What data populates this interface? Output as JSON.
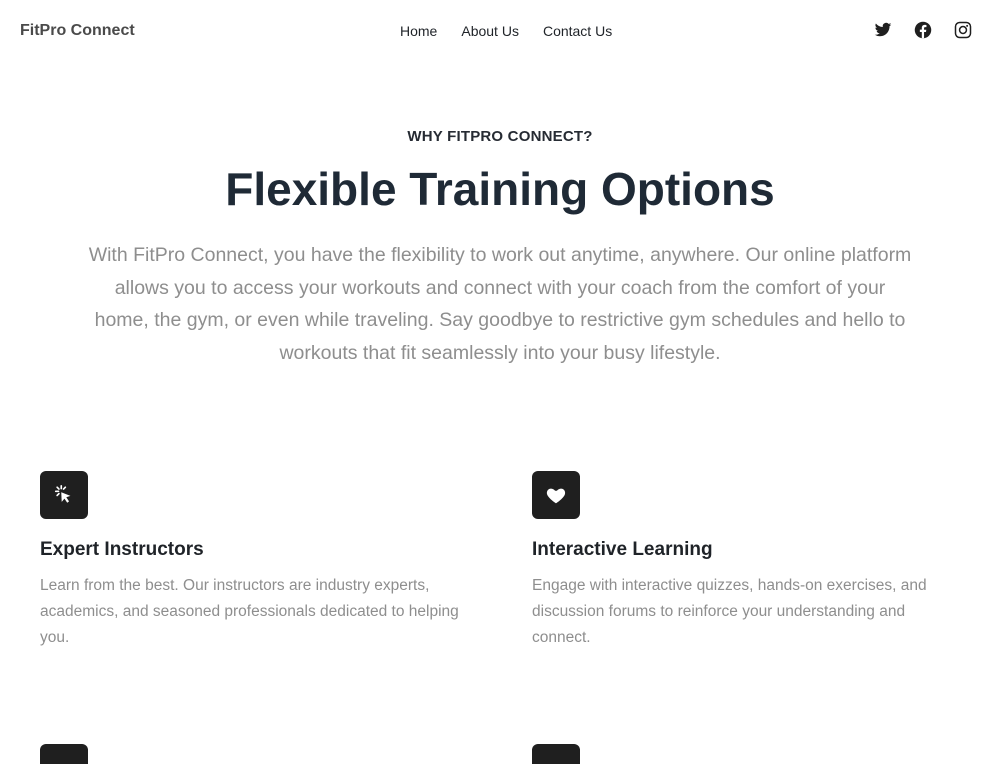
{
  "header": {
    "brand": "FitPro Connect",
    "nav": [
      {
        "label": "Home"
      },
      {
        "label": "About Us"
      },
      {
        "label": "Contact Us"
      }
    ],
    "social": [
      "twitter-icon",
      "facebook-icon",
      "instagram-icon"
    ]
  },
  "hero": {
    "eyebrow": "WHY FITPRO CONNECT?",
    "title": "Flexible Training Options",
    "description": "With FitPro Connect, you have the flexibility to work out anytime, anywhere. Our online platform allows you to access your workouts and connect with your coach from the comfort of your home, the gym, or even while traveling. Say goodbye to restrictive gym schedules and hello to workouts that fit seamlessly into your busy lifestyle."
  },
  "features": [
    {
      "icon": "cursor-click-icon",
      "title": "Expert Instructors",
      "description": "Learn from the best. Our instructors are industry experts, academics, and seasoned professionals dedicated to helping you."
    },
    {
      "icon": "heart-icon",
      "title": "Interactive Learning",
      "description": "Engage with interactive quizzes, hands-on exercises, and discussion forums to reinforce your understanding and connect."
    }
  ],
  "colors": {
    "icon_bg": "#1f1f1f",
    "heading": "#1f2a36",
    "muted_text": "#8e8e8e"
  }
}
